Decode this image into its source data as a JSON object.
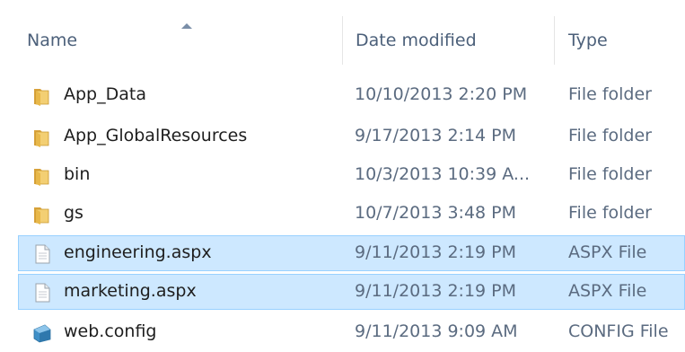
{
  "columns": {
    "name": "Name",
    "date": "Date modified",
    "type": "Type"
  },
  "sort": {
    "column": "name",
    "direction": "ascending",
    "icon": "sort-ascending-icon"
  },
  "colors": {
    "selection": "#cde8ff",
    "selection_border": "#99d1ff",
    "folder": "#e8b84a"
  },
  "files": [
    {
      "name": "App_Data",
      "date": "10/10/2013 2:20 PM",
      "type": "File folder",
      "icon": "folder-icon",
      "selected": false
    },
    {
      "name": "App_GlobalResources",
      "date": "9/17/2013 2:14 PM",
      "type": "File folder",
      "icon": "folder-icon",
      "selected": false
    },
    {
      "name": "bin",
      "date": "10/3/2013 10:39 A...",
      "type": "File folder",
      "icon": "folder-icon",
      "selected": false
    },
    {
      "name": "gs",
      "date": "10/7/2013 3:48 PM",
      "type": "File folder",
      "icon": "folder-icon",
      "selected": false
    },
    {
      "name": "engineering.aspx",
      "date": "9/11/2013 2:19 PM",
      "type": "ASPX File",
      "icon": "document-icon",
      "selected": true
    },
    {
      "name": "marketing.aspx",
      "date": "9/11/2013 2:19 PM",
      "type": "ASPX File",
      "icon": "document-icon",
      "selected": true
    },
    {
      "name": "web.config",
      "date": "9/11/2013 9:09 AM",
      "type": "CONFIG File",
      "icon": "config-file-icon",
      "selected": false
    }
  ]
}
